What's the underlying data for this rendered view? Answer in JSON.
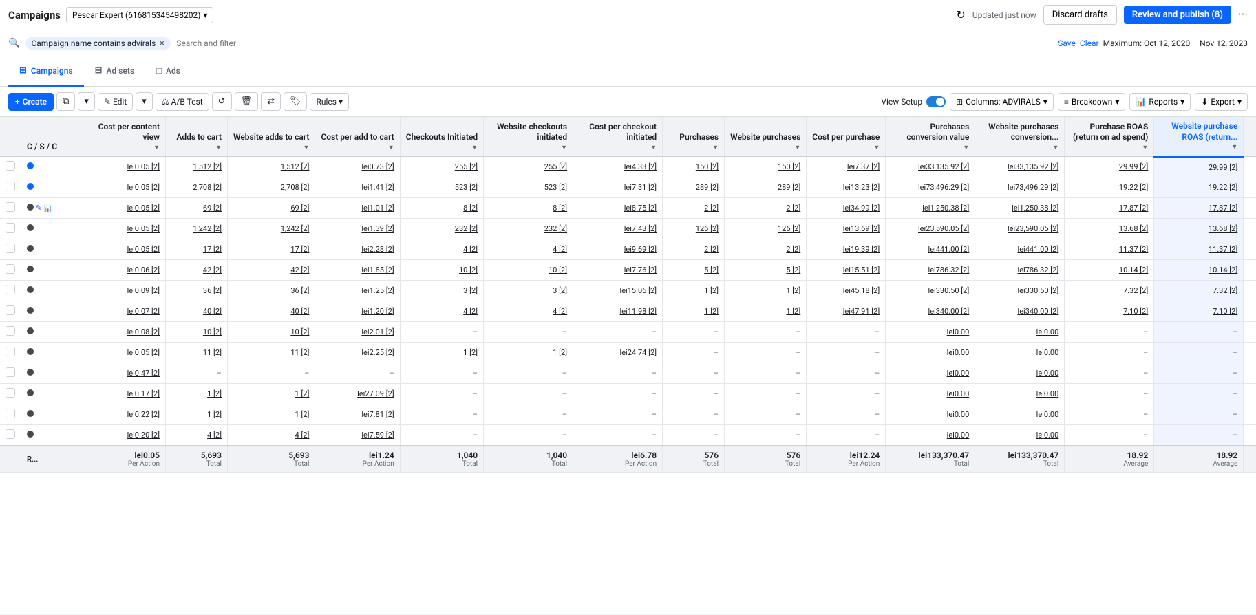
{
  "topBar": {
    "title": "Campaigns",
    "account": "Pescar Expert (616815345498202)",
    "updatedText": "Updated just now",
    "discardLabel": "Discard drafts",
    "reviewLabel": "Review and publish (8)"
  },
  "filterBar": {
    "filterTag": "Campaign name contains advirals",
    "searchPlaceholder": "Search and filter",
    "saveLabel": "Save",
    "clearLabel": "Clear",
    "dateRange": "Maximum: Oct 12, 2020 – Nov 12, 2023"
  },
  "navTabs": {
    "tabs": [
      {
        "id": "campaigns",
        "label": "Campaigns",
        "active": true
      },
      {
        "id": "adsets",
        "label": "Ad sets",
        "active": false
      },
      {
        "id": "ads",
        "label": "Ads",
        "active": false
      }
    ]
  },
  "toolbar": {
    "createLabel": "+ Create",
    "editLabel": "Edit",
    "abTestLabel": "A/B Test",
    "undoLabel": "↺",
    "deleteLabel": "🗑",
    "rulesLabel": "Rules ▾",
    "viewSetupLabel": "View Setup",
    "columnsLabel": "Columns: ADVIRALS",
    "breakdownLabel": "Breakdown",
    "reportsLabel": "Reports",
    "exportLabel": "Export"
  },
  "table": {
    "columns": [
      {
        "id": "check",
        "label": "",
        "type": "check"
      },
      {
        "id": "status",
        "label": "C / S / C",
        "type": "status"
      },
      {
        "id": "cost_content_view",
        "label": "Cost per content view",
        "sortable": true
      },
      {
        "id": "adds_to_cart",
        "label": "Adds to cart",
        "sortable": true
      },
      {
        "id": "website_adds_to_cart",
        "label": "Website adds to cart",
        "sortable": true
      },
      {
        "id": "cost_add_to_cart",
        "label": "Cost per add to cart",
        "sortable": true
      },
      {
        "id": "checkouts_initiated",
        "label": "Checkouts Initiated",
        "sortable": true
      },
      {
        "id": "website_checkouts_initiated",
        "label": "Website checkouts initiated",
        "sortable": true
      },
      {
        "id": "cost_checkout_initiated",
        "label": "Cost per checkout initiated",
        "sortable": true
      },
      {
        "id": "purchases",
        "label": "Purchases",
        "sortable": true
      },
      {
        "id": "website_purchases",
        "label": "Website purchases",
        "sortable": true
      },
      {
        "id": "cost_per_purchase",
        "label": "Cost per purchase",
        "sortable": true
      },
      {
        "id": "purchases_conversion_value",
        "label": "Purchases conversion value",
        "sortable": true
      },
      {
        "id": "website_purchases_conversion",
        "label": "Website purchases conversion...",
        "sortable": true
      },
      {
        "id": "purchase_roas",
        "label": "Purchase ROAS (return on ad spend)",
        "sortable": true
      },
      {
        "id": "website_purchase_roas",
        "label": "Website purchase ROAS (return...",
        "sortable": true,
        "highlighted": true
      }
    ],
    "rows": [
      {
        "status": "blue",
        "cost_content_view": "lei0.05 [2]",
        "adds_to_cart": "1,512 [2]",
        "website_adds_to_cart": "1,512 [2]",
        "cost_add_to_cart": "lei0.73 [2]",
        "checkouts_initiated": "255 [2]",
        "website_checkouts_initiated": "255 [2]",
        "cost_checkout_initiated": "lei4.33 [2]",
        "purchases": "150 [2]",
        "website_purchases": "150 [2]",
        "cost_per_purchase": "lei7.37 [2]",
        "purchases_conversion_value": "lei33,135.92 [2]",
        "website_purchases_conversion": "lei33,135.92 [2]",
        "purchase_roas": "29.99 [2]",
        "website_purchase_roas": "29.99 [2]"
      },
      {
        "status": "blue",
        "cost_content_view": "lei0.05 [2]",
        "adds_to_cart": "2,708 [2]",
        "website_adds_to_cart": "2,708 [2]",
        "cost_add_to_cart": "lei1.41 [2]",
        "checkouts_initiated": "523 [2]",
        "website_checkouts_initiated": "523 [2]",
        "cost_checkout_initiated": "lei7.31 [2]",
        "purchases": "289 [2]",
        "website_purchases": "289 [2]",
        "cost_per_purchase": "lei13.23 [2]",
        "purchases_conversion_value": "lei73,496.29 [2]",
        "website_purchases_conversion": "lei73,496.29 [2]",
        "purchase_roas": "19.22 [2]",
        "website_purchase_roas": "19.22 [2]"
      },
      {
        "status": "dark",
        "cost_content_view": "lei0.05 [2]",
        "adds_to_cart": "69 [2]",
        "website_adds_to_cart": "69 [2]",
        "cost_add_to_cart": "lei1.01 [2]",
        "checkouts_initiated": "8 [2]",
        "website_checkouts_initiated": "8 [2]",
        "cost_checkout_initiated": "lei8.75 [2]",
        "purchases": "2 [2]",
        "website_purchases": "2 [2]",
        "cost_per_purchase": "lei34.99 [2]",
        "purchases_conversion_value": "lei1,250.38 [2]",
        "website_purchases_conversion": "lei1,250.38 [2]",
        "purchase_roas": "17.87 [2]",
        "website_purchase_roas": "17.87 [2]",
        "hasEdit": true
      },
      {
        "status": "dark",
        "cost_content_view": "lei0.05 [2]",
        "adds_to_cart": "1,242 [2]",
        "website_adds_to_cart": "1,242 [2]",
        "cost_add_to_cart": "lei1.39 [2]",
        "checkouts_initiated": "232 [2]",
        "website_checkouts_initiated": "232 [2]",
        "cost_checkout_initiated": "lei7.43 [2]",
        "purchases": "126 [2]",
        "website_purchases": "126 [2]",
        "cost_per_purchase": "lei13.69 [2]",
        "purchases_conversion_value": "lei23,590.05 [2]",
        "website_purchases_conversion": "lei23,590.05 [2]",
        "purchase_roas": "13.68 [2]",
        "website_purchase_roas": "13.68 [2]"
      },
      {
        "status": "dark",
        "cost_content_view": "lei0.05 [2]",
        "adds_to_cart": "17 [2]",
        "website_adds_to_cart": "17 [2]",
        "cost_add_to_cart": "lei2.28 [2]",
        "checkouts_initiated": "4 [2]",
        "website_checkouts_initiated": "4 [2]",
        "cost_checkout_initiated": "lei9.69 [2]",
        "purchases": "2 [2]",
        "website_purchases": "2 [2]",
        "cost_per_purchase": "lei19.39 [2]",
        "purchases_conversion_value": "lei441.00 [2]",
        "website_purchases_conversion": "lei441.00 [2]",
        "purchase_roas": "11.37 [2]",
        "website_purchase_roas": "11.37 [2]"
      },
      {
        "status": "dark",
        "cost_content_view": "lei0.06 [2]",
        "adds_to_cart": "42 [2]",
        "website_adds_to_cart": "42 [2]",
        "cost_add_to_cart": "lei1.85 [2]",
        "checkouts_initiated": "10 [2]",
        "website_checkouts_initiated": "10 [2]",
        "cost_checkout_initiated": "lei7.76 [2]",
        "purchases": "5 [2]",
        "website_purchases": "5 [2]",
        "cost_per_purchase": "lei15.51 [2]",
        "purchases_conversion_value": "lei786.32 [2]",
        "website_purchases_conversion": "lei786.32 [2]",
        "purchase_roas": "10.14 [2]",
        "website_purchase_roas": "10.14 [2]"
      },
      {
        "status": "dark",
        "cost_content_view": "lei0.09 [2]",
        "adds_to_cart": "36 [2]",
        "website_adds_to_cart": "36 [2]",
        "cost_add_to_cart": "lei1.25 [2]",
        "checkouts_initiated": "3 [2]",
        "website_checkouts_initiated": "3 [2]",
        "cost_checkout_initiated": "lei15.06 [2]",
        "purchases": "1 [2]",
        "website_purchases": "1 [2]",
        "cost_per_purchase": "lei45.18 [2]",
        "purchases_conversion_value": "lei330.50 [2]",
        "website_purchases_conversion": "lei330.50 [2]",
        "purchase_roas": "7.32 [2]",
        "website_purchase_roas": "7.32 [2]"
      },
      {
        "status": "dark",
        "cost_content_view": "lei0.07 [2]",
        "adds_to_cart": "40 [2]",
        "website_adds_to_cart": "40 [2]",
        "cost_add_to_cart": "lei1.20 [2]",
        "checkouts_initiated": "4 [2]",
        "website_checkouts_initiated": "4 [2]",
        "cost_checkout_initiated": "lei11.98 [2]",
        "purchases": "1 [2]",
        "website_purchases": "1 [2]",
        "cost_per_purchase": "lei47.91 [2]",
        "purchases_conversion_value": "lei340.00 [2]",
        "website_purchases_conversion": "lei340.00 [2]",
        "purchase_roas": "7.10 [2]",
        "website_purchase_roas": "7.10 [2]"
      },
      {
        "status": "dark",
        "cost_content_view": "lei0.08 [2]",
        "adds_to_cart": "10 [2]",
        "website_adds_to_cart": "10 [2]",
        "cost_add_to_cart": "lei2.01 [2]",
        "checkouts_initiated": "–",
        "website_checkouts_initiated": "–",
        "cost_checkout_initiated": "–",
        "purchases": "–",
        "website_purchases": "–",
        "cost_per_purchase": "–",
        "purchases_conversion_value": "lei0.00",
        "website_purchases_conversion": "lei0.00",
        "purchase_roas": "–",
        "website_purchase_roas": "–"
      },
      {
        "status": "dark",
        "cost_content_view": "lei0.05 [2]",
        "adds_to_cart": "11 [2]",
        "website_adds_to_cart": "11 [2]",
        "cost_add_to_cart": "lei2.25 [2]",
        "checkouts_initiated": "1 [2]",
        "website_checkouts_initiated": "1 [2]",
        "cost_checkout_initiated": "lei24.74 [2]",
        "purchases": "–",
        "website_purchases": "–",
        "cost_per_purchase": "–",
        "purchases_conversion_value": "lei0.00",
        "website_purchases_conversion": "lei0.00",
        "purchase_roas": "–",
        "website_purchase_roas": "–"
      },
      {
        "status": "dark",
        "cost_content_view": "lei0.47 [2]",
        "adds_to_cart": "–",
        "website_adds_to_cart": "–",
        "cost_add_to_cart": "–",
        "checkouts_initiated": "–",
        "website_checkouts_initiated": "–",
        "cost_checkout_initiated": "–",
        "purchases": "–",
        "website_purchases": "–",
        "cost_per_purchase": "–",
        "purchases_conversion_value": "lei0.00",
        "website_purchases_conversion": "lei0.00",
        "purchase_roas": "–",
        "website_purchase_roas": "–"
      },
      {
        "status": "dark",
        "cost_content_view": "lei0.17 [2]",
        "adds_to_cart": "1 [2]",
        "website_adds_to_cart": "1 [2]",
        "cost_add_to_cart": "lei27.09 [2]",
        "checkouts_initiated": "–",
        "website_checkouts_initiated": "–",
        "cost_checkout_initiated": "–",
        "purchases": "–",
        "website_purchases": "–",
        "cost_per_purchase": "–",
        "purchases_conversion_value": "lei0.00",
        "website_purchases_conversion": "lei0.00",
        "purchase_roas": "–",
        "website_purchase_roas": "–"
      },
      {
        "status": "dark",
        "cost_content_view": "lei0.22 [2]",
        "adds_to_cart": "1 [2]",
        "website_adds_to_cart": "1 [2]",
        "cost_add_to_cart": "lei7.81 [2]",
        "checkouts_initiated": "–",
        "website_checkouts_initiated": "–",
        "cost_checkout_initiated": "–",
        "purchases": "–",
        "website_purchases": "–",
        "cost_per_purchase": "–",
        "purchases_conversion_value": "lei0.00",
        "website_purchases_conversion": "lei0.00",
        "purchase_roas": "–",
        "website_purchase_roas": "–"
      },
      {
        "status": "dark",
        "cost_content_view": "lei0.20 [2]",
        "adds_to_cart": "4 [2]",
        "website_adds_to_cart": "4 [2]",
        "cost_add_to_cart": "lei7.59 [2]",
        "checkouts_initiated": "–",
        "website_checkouts_initiated": "–",
        "cost_checkout_initiated": "–",
        "purchases": "–",
        "website_purchases": "–",
        "cost_per_purchase": "–",
        "purchases_conversion_value": "lei0.00",
        "website_purchases_conversion": "lei0.00",
        "purchase_roas": "–",
        "website_purchase_roas": "–"
      }
    ],
    "footer": {
      "label": "R...",
      "cost_content_view": "lei0.05",
      "cost_content_view_sub": "Per Action",
      "adds_to_cart": "5,693",
      "adds_to_cart_sub": "Total",
      "website_adds_to_cart": "5,693",
      "website_adds_to_cart_sub": "Total",
      "cost_add_to_cart": "lei1.24",
      "cost_add_to_cart_sub": "Per Action",
      "checkouts_initiated": "1,040",
      "checkouts_initiated_sub": "Total",
      "website_checkouts_initiated": "1,040",
      "website_checkouts_initiated_sub": "Total",
      "cost_checkout_initiated": "lei6.78",
      "cost_checkout_initiated_sub": "Per Action",
      "purchases": "576",
      "purchases_sub": "Total",
      "website_purchases": "576",
      "website_purchases_sub": "Total",
      "cost_per_purchase": "lei12.24",
      "cost_per_purchase_sub": "Per Action",
      "purchases_conversion_value": "lei133,370.47",
      "purchases_conversion_value_sub": "Total",
      "website_purchases_conversion": "lei133,370.47",
      "website_purchases_conversion_sub": "Total",
      "purchase_roas": "18.92",
      "purchase_roas_sub": "Average",
      "website_purchase_roas": "18.92",
      "website_purchase_roas_sub": "Average"
    }
  }
}
